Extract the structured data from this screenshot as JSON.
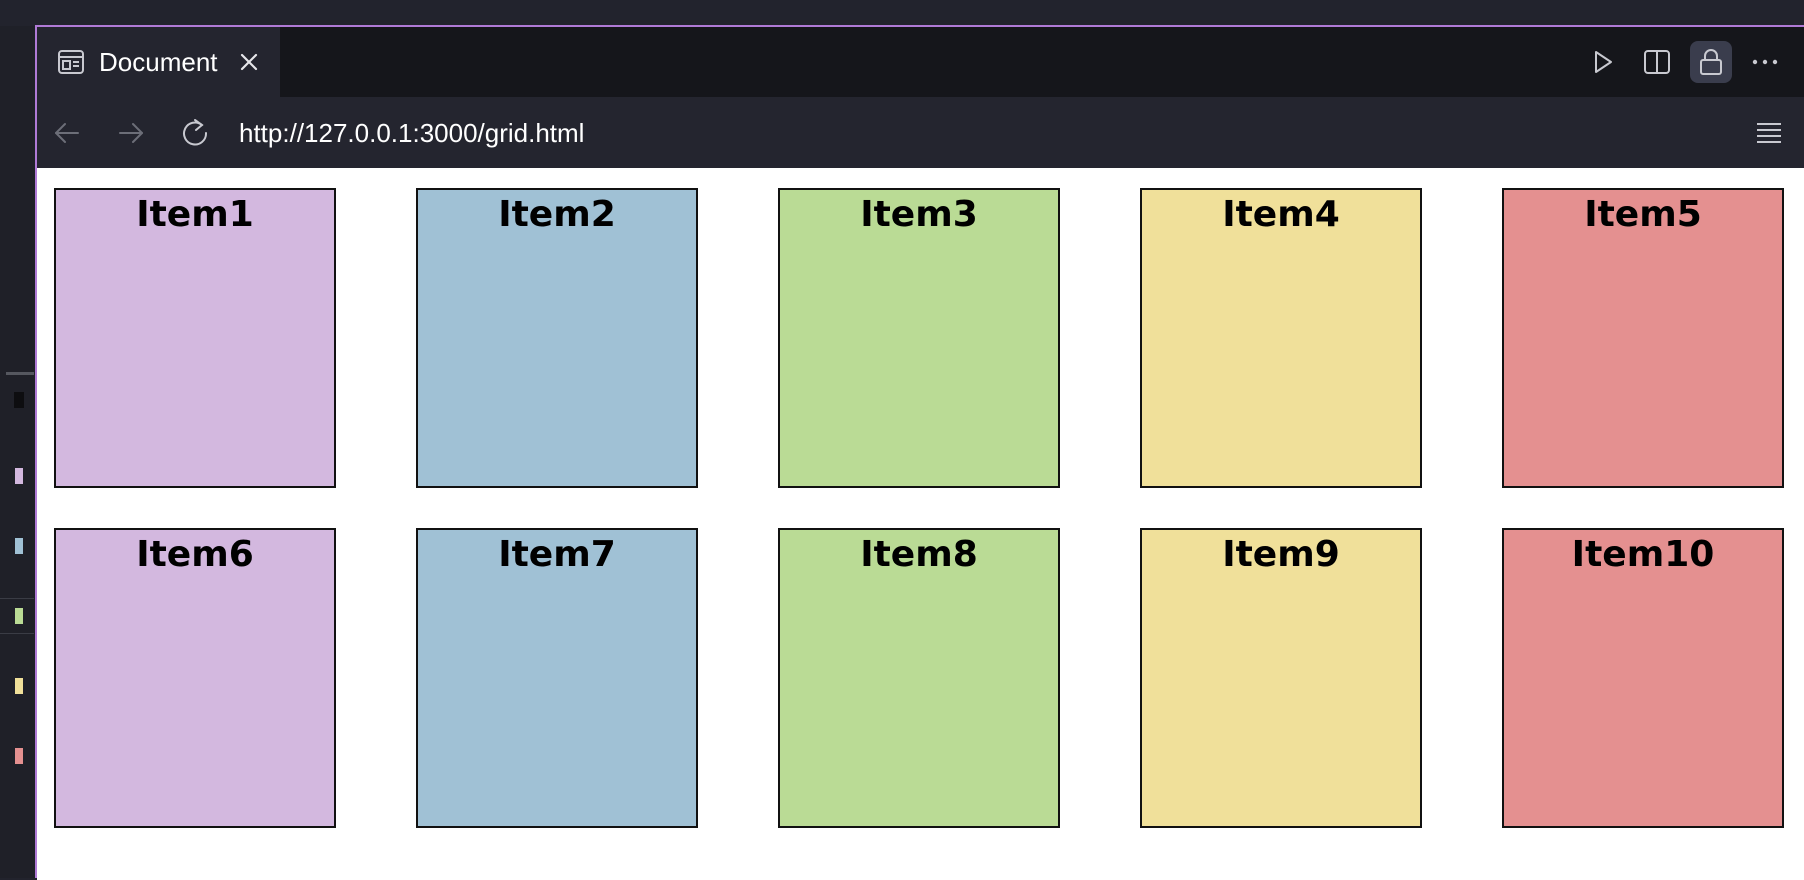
{
  "tab": {
    "title": "Document",
    "icon": "document-preview-icon"
  },
  "toolbar_icons": [
    "play-icon",
    "split-view-icon",
    "lock-icon",
    "more-icon"
  ],
  "nav": {
    "url": "http://127.0.0.1:3000/grid.html"
  },
  "colors": {
    "accent": "#b07ad6",
    "purple": "#d3b8df",
    "blue": "#a0c1d5",
    "green": "#badb95",
    "yellow": "#f0e09a",
    "red": "#e49090"
  },
  "grid": {
    "items": [
      {
        "label": "Item1",
        "color": "#d3b8df"
      },
      {
        "label": "Item2",
        "color": "#a0c1d5"
      },
      {
        "label": "Item3",
        "color": "#badb95"
      },
      {
        "label": "Item4",
        "color": "#f0e09a"
      },
      {
        "label": "Item5",
        "color": "#e49090"
      },
      {
        "label": "Item6",
        "color": "#d3b8df"
      },
      {
        "label": "Item7",
        "color": "#a0c1d5"
      },
      {
        "label": "Item8",
        "color": "#badb95"
      },
      {
        "label": "Item9",
        "color": "#f0e09a"
      },
      {
        "label": "Item10",
        "color": "#e49090"
      }
    ]
  }
}
